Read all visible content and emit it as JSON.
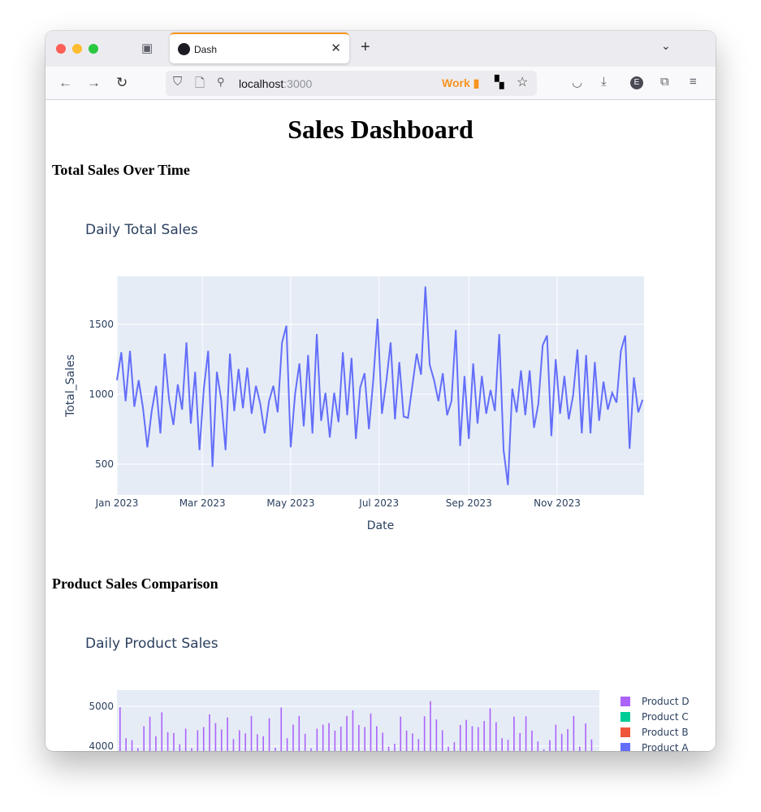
{
  "browser": {
    "tab_title": "Dash",
    "url_host": "localhost",
    "url_port": ":3000",
    "container_label": "Work"
  },
  "page": {
    "title": "Sales Dashboard",
    "section1": "Total Sales Over Time",
    "section2": "Product Sales Comparison"
  },
  "chart_data": [
    {
      "type": "line",
      "title": "Daily Total Sales",
      "xlabel": "Date",
      "ylabel": "Total_Sales",
      "x_start": "2023-01-01",
      "x_step_days": 3,
      "x_range": [
        "2023-01-01",
        "2023-12-31"
      ],
      "ylim": [
        279,
        1843
      ],
      "x_ticks": [
        "Jan 2023",
        "Mar 2023",
        "May 2023",
        "Jul 2023",
        "Sep 2023",
        "Nov 2023"
      ],
      "y_ticks": [
        500,
        1000,
        1500
      ],
      "grid": true,
      "color": "#636efa",
      "values": [
        1100,
        1300,
        950,
        1310,
        910,
        1100,
        900,
        620,
        880,
        1060,
        720,
        1290,
        960,
        780,
        1070,
        890,
        1370,
        790,
        1160,
        600,
        1040,
        1310,
        480,
        1160,
        960,
        600,
        1290,
        880,
        1180,
        900,
        1190,
        860,
        1060,
        930,
        720,
        950,
        1060,
        870,
        1370,
        1490,
        620,
        1000,
        1220,
        770,
        1280,
        720,
        1430,
        810,
        1010,
        690,
        1010,
        800,
        1300,
        850,
        1260,
        680,
        1050,
        1150,
        750,
        1100,
        1540,
        860,
        1090,
        1370,
        820,
        1230,
        840,
        830,
        1060,
        1290,
        1140,
        1770,
        1210,
        1100,
        950,
        1150,
        850,
        950,
        1460,
        630,
        1130,
        680,
        1220,
        790,
        1130,
        860,
        1030,
        880,
        1430,
        600,
        350,
        1040,
        870,
        1170,
        850,
        1170,
        760,
        930,
        1350,
        1420,
        700,
        1250,
        860,
        1130,
        820,
        990,
        1320,
        720,
        1280,
        720,
        1230,
        810,
        1090,
        890,
        1010,
        940,
        1310,
        1420,
        610,
        1120,
        870,
        960
      ]
    },
    {
      "type": "bar",
      "title": "Daily Product Sales",
      "stacked": true,
      "ylim_top": 5408,
      "y_ticks": [
        4000,
        5000
      ],
      "grid": true,
      "legend": "right",
      "series": [
        {
          "name": "Product D",
          "color": "#ab63fa"
        },
        {
          "name": "Product C",
          "color": "#00cc96"
        },
        {
          "name": "Product B",
          "color": "#ef553b"
        },
        {
          "name": "Product A",
          "color": "#636efa"
        }
      ],
      "x_step_days": 3,
      "stack_totals": [
        4980,
        4200,
        4150,
        3950,
        4500,
        4740,
        4250,
        4850,
        4350,
        4330,
        4050,
        4440,
        3950,
        4400,
        4480,
        4800,
        4580,
        4420,
        4720,
        4180,
        4400,
        4320,
        4760,
        4300,
        4250,
        4700,
        3960,
        4970,
        4200,
        4540,
        4760,
        4310,
        3950,
        4440,
        4540,
        4580,
        4390,
        4490,
        4760,
        4900,
        4530,
        4480,
        4820,
        4500,
        4340,
        3990,
        4060,
        4740,
        4390,
        4320,
        4180,
        4750,
        5130,
        4670,
        4400,
        3990,
        4100,
        4530,
        4660,
        4500,
        4480,
        4630,
        4950,
        4600,
        4200,
        4160,
        4740,
        4330,
        4750,
        4390,
        4120,
        3920,
        4150,
        4540,
        4310,
        4430,
        4760,
        3990,
        4570,
        4170
      ]
    }
  ]
}
